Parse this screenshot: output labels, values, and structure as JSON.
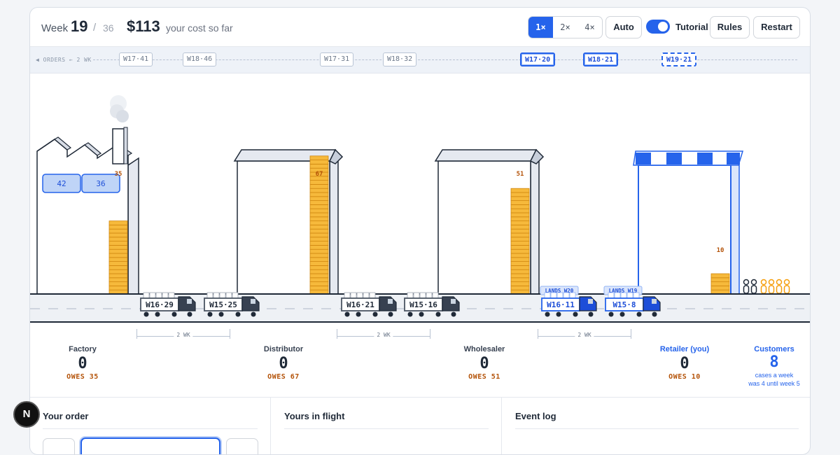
{
  "header": {
    "week_label": "Week",
    "week": "19",
    "slash": "/",
    "total_weeks": "36",
    "cost": "$113",
    "cost_label": "your cost so far",
    "speeds": [
      "1×",
      "2×",
      "4×"
    ],
    "active_speed": "1×",
    "auto_label": "Auto",
    "tutorial_label": "Tutorial",
    "tutorial_on": true,
    "rules_label": "Rules",
    "restart_label": "Restart"
  },
  "orders_band": {
    "label": "◀ ORDERS ← 2 WK",
    "tags": [
      {
        "text": "W17·41",
        "style": "normal"
      },
      {
        "text": "W18·46",
        "style": "normal"
      },
      {
        "text": "W17·31",
        "style": "normal"
      },
      {
        "text": "W18·32",
        "style": "normal"
      },
      {
        "text": "W17·20",
        "style": "blue"
      },
      {
        "text": "W18·21",
        "style": "blue"
      },
      {
        "text": "W19·21",
        "style": "dashed"
      }
    ]
  },
  "scene": {
    "factory_production": [
      "42",
      "36"
    ],
    "stock_labels": [
      "35",
      "67",
      "51",
      "10"
    ],
    "stock_counts": [
      35,
      67,
      51,
      10
    ],
    "trucks": [
      {
        "label": "W16·29",
        "mine": false,
        "lands": ""
      },
      {
        "label": "W15·25",
        "mine": false,
        "lands": ""
      },
      {
        "label": "W16·21",
        "mine": false,
        "lands": ""
      },
      {
        "label": "W15·16",
        "mine": false,
        "lands": ""
      },
      {
        "label": "W16·11",
        "mine": true,
        "lands": "LANDS W20"
      },
      {
        "label": "W15·8",
        "mine": true,
        "lands": "LANDS W19"
      }
    ],
    "lead_labels": [
      "2 WK",
      "2 WK",
      "2 WK"
    ],
    "customers_waiting": {
      "served": 2,
      "waiting": 4
    }
  },
  "stages": [
    {
      "name": "Factory",
      "value": "0",
      "owes": "OWES 35"
    },
    {
      "name": "Distributor",
      "value": "0",
      "owes": "OWES 67"
    },
    {
      "name": "Wholesaler",
      "value": "0",
      "owes": "OWES 51"
    },
    {
      "name": "Retailer (you)",
      "value": "0",
      "owes": "OWES 10"
    }
  ],
  "customers": {
    "name": "Customers",
    "value": "8",
    "line1": "cases a week",
    "line2": "was 4 until week 5"
  },
  "panels": {
    "order_title": "Your order",
    "flight_title": "Yours in flight",
    "log_title": "Event log"
  },
  "badge": "N",
  "colors": {
    "accent": "#2563eb",
    "stock": "#f6b93b",
    "owes": "#b45309"
  }
}
